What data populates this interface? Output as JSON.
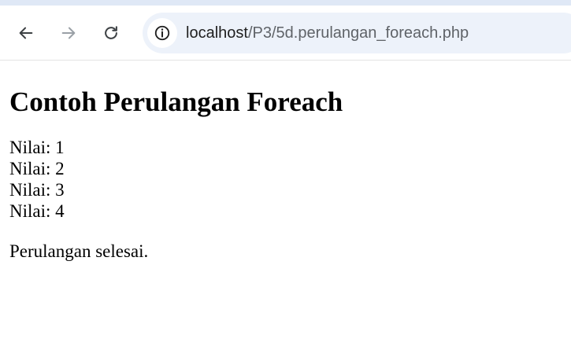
{
  "browser": {
    "url_host": "localhost",
    "url_path": "/P3/5d.perulangan_foreach.php",
    "icons": {
      "back": "arrow-left-icon",
      "forward": "arrow-right-icon",
      "reload": "reload-icon",
      "site_info": "info-icon"
    },
    "colors": {
      "omnibox_bg": "#edf2fa",
      "top_strip": "#dfe8f6",
      "icon_active": "#3c4043",
      "icon_disabled": "#9aa0a6"
    }
  },
  "page": {
    "heading": "Contoh Perulangan Foreach",
    "values": [
      "Nilai: 1",
      "Nilai: 2",
      "Nilai: 3",
      "Nilai: 4"
    ],
    "done_message": "Perulangan selesai."
  }
}
